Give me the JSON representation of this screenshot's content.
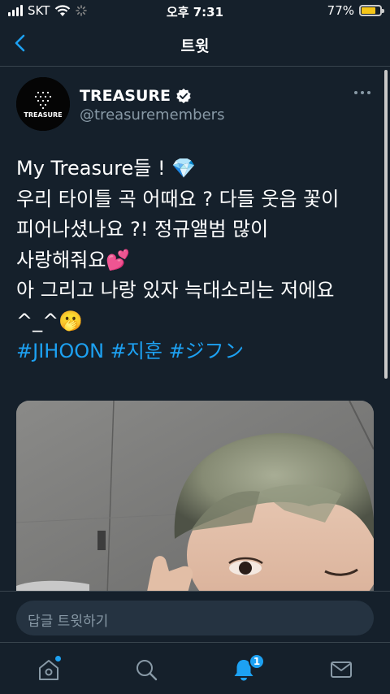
{
  "status_bar": {
    "carrier": "SKT",
    "time": "오후 7:31",
    "battery_percent": "77%",
    "battery_level": 0.77
  },
  "nav": {
    "title": "트윗",
    "back_icon": "chevron-left-icon"
  },
  "tweet": {
    "display_name": "TREASURE",
    "handle": "@treasuremembers",
    "avatar_logo_text": "TREASURE",
    "text_lines": [
      "My Treasure들 ! 💎",
      "우리 타이틀 곡 어때요 ? 다들 웃음 꽃이",
      "피어나셨나요 ?! 정규앨범 많이",
      "사랑해줘요💕",
      "아 그리고 나랑 있자 늑대소리는 저에요",
      "^_^🫢"
    ],
    "hashtags": "#JIHOON #지훈 #ジフン"
  },
  "reply": {
    "placeholder": "답글 트윗하기"
  },
  "tabs": {
    "notification_count": "1"
  },
  "colors": {
    "background": "#15202b",
    "accent": "#1da1f2",
    "muted": "#8899a6",
    "divider": "#38444d"
  }
}
